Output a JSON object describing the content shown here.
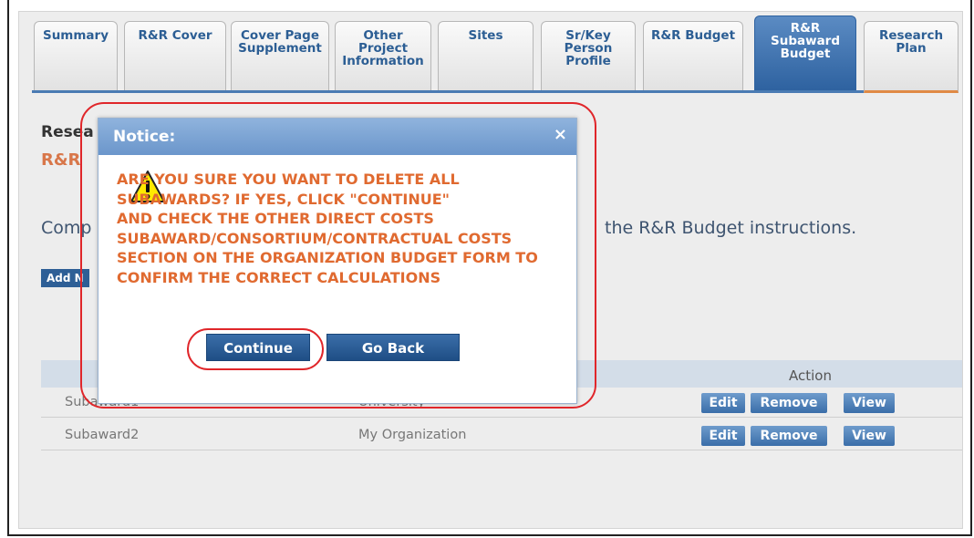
{
  "tabs": [
    {
      "label": "Summary"
    },
    {
      "label": "R&R Cover"
    },
    {
      "label": "Cover Page\nSupplement"
    },
    {
      "label": "Other\nProject\nInformation"
    },
    {
      "label": "Sites"
    },
    {
      "label": "Sr/Key\nPerson\nProfile"
    },
    {
      "label": "R&R Budget"
    },
    {
      "label": "R&R\nSubaward\nBudget"
    },
    {
      "label": "Research\nPlan"
    }
  ],
  "background": {
    "heading": "Resea",
    "subheading": "R&R ",
    "text_left": "Comp",
    "text_right": "the R&R Budget instructions.",
    "add_button": "Add N"
  },
  "table": {
    "action_header": "Action",
    "rows": [
      {
        "name": "Subaward1",
        "org": "University"
      },
      {
        "name": "Subaward2",
        "org": "My Organization"
      }
    ],
    "edit_label": "Edit",
    "remove_label": "Remove",
    "view_label": "View"
  },
  "modal": {
    "title": "Notice:",
    "close_glyph": "×",
    "message": "        ARE YOU SURE YOU WANT TO DELETE ALL\n        SUBAWARDS? IF YES, CLICK \"CONTINUE\"\nAND CHECK THE OTHER DIRECT COSTS\nSUBAWARD/CONSORTIUM/CONTRACTUAL COSTS\nSECTION ON THE ORGANIZATION BUDGET FORM TO\nCONFIRM THE CORRECT CALCULATIONS",
    "continue_label": "Continue",
    "goback_label": "Go Back",
    "icon": "warning-icon"
  },
  "colors": {
    "accent": "#2e62a0",
    "warning_text": "#e06a30",
    "annotation": "#e0262a"
  }
}
